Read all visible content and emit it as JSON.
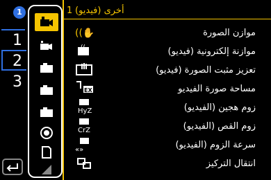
{
  "header": {
    "title": "أخرى (فيديو)",
    "page": "1"
  },
  "page_numbers": [
    "1",
    "2",
    "3"
  ],
  "marker": "1",
  "tabs": [
    {
      "name": "video-camera-icon",
      "active": true
    },
    {
      "name": "photo-video-camera-icon",
      "active": false
    },
    {
      "name": "camera-icon",
      "active": false
    },
    {
      "name": "camera-icon",
      "active": false
    },
    {
      "name": "camera-icon",
      "active": false
    },
    {
      "name": "circle-icon",
      "active": false
    },
    {
      "name": "document-icon",
      "active": false
    },
    {
      "name": "wifi-icon",
      "active": false
    }
  ],
  "items": [
    {
      "label": "موازن الصورة",
      "icon": "hand-shake-icon"
    },
    {
      "label": "موازنة إلكترونية (فيديو)",
      "icon": "electronic-stabilizer-icon"
    },
    {
      "label": "تعزيز مثبت الصورة (فيديو)",
      "icon": "boost-stabilizer-icon"
    },
    {
      "label": "مساحة صورة الفيديو",
      "icon": "ex-tele-icon"
    },
    {
      "label": "زوم هجين (الفيديو)",
      "icon": "hybrid-zoom-icon"
    },
    {
      "label": "زوم القص (الفيديو)",
      "icon": "crop-zoom-icon"
    },
    {
      "label": "سرعة الزوم (الفيديو)",
      "icon": "zoom-speed-icon"
    },
    {
      "label": "انتقال التركيز",
      "icon": "focus-transition-icon"
    }
  ],
  "colors": {
    "accent": "#f5c400",
    "selection": "#2f6fe0"
  }
}
